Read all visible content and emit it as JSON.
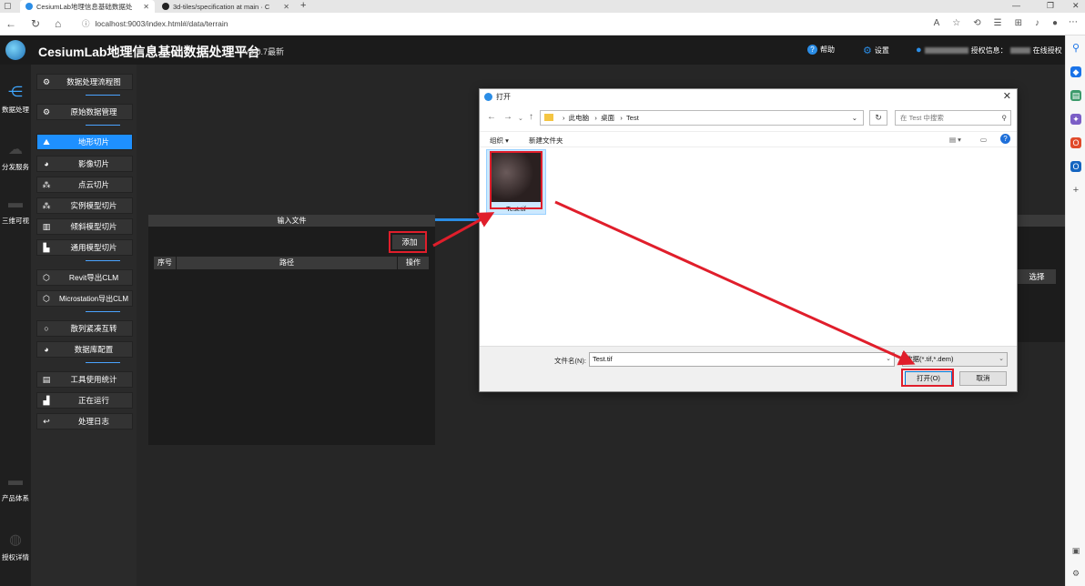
{
  "browser": {
    "tabs": [
      {
        "label": "CesiumLab地理信息基础数据处",
        "active": true
      },
      {
        "label": "3d-tiles/specification at main · C",
        "active": false
      }
    ],
    "url": "localhost:9003/index.html#/data/terrain",
    "nav_icons": [
      "back-icon",
      "refresh-icon",
      "home-icon",
      "info-icon",
      "read-aloud-icon",
      "favorite-icon",
      "extensions-icon",
      "favorites-icon",
      "collections-icon",
      "bell-icon",
      "profile-icon",
      "more-icon"
    ]
  },
  "app": {
    "title": "CesiumLab地理信息基础数据处理平台",
    "version": "V3.0.7最新",
    "header": {
      "help": "帮助",
      "settings": "设置",
      "license_prefix": "授权信息：",
      "license_status": "在线授权"
    },
    "leftnav": [
      {
        "label": "数据处理",
        "icon": "data-process-icon"
      },
      {
        "label": "分发服务",
        "icon": "cloud-icon"
      },
      {
        "label": "三维可视",
        "icon": "3d-view-icon"
      },
      {
        "label": "产品体系",
        "icon": "product-icon"
      },
      {
        "label": "授权详情",
        "icon": "globe-icon"
      }
    ],
    "menu": [
      {
        "label": "数据处理流程图",
        "icon": "gear-icon"
      },
      {
        "label": "原始数据管理",
        "icon": "gear-icon"
      },
      {
        "label": "地形切片",
        "icon": "terrain-icon",
        "active": true
      },
      {
        "label": "影像切片",
        "icon": "globe-icon"
      },
      {
        "label": "点云切片",
        "icon": "nodes-icon"
      },
      {
        "label": "实例模型切片",
        "icon": "nodes-icon"
      },
      {
        "label": "倾斜模型切片",
        "icon": "building-icon"
      },
      {
        "label": "通用模型切片",
        "icon": "model-icon"
      },
      {
        "label": "Revit导出CLM",
        "icon": "hex-icon"
      },
      {
        "label": "Microstation导出CLM",
        "icon": "hex-icon"
      },
      {
        "label": "散列紧凑互转",
        "icon": "convert-icon"
      },
      {
        "label": "数据库配置",
        "icon": "globe-icon"
      },
      {
        "label": "工具使用统计",
        "icon": "doc-icon"
      },
      {
        "label": "正在运行",
        "icon": "chart-icon"
      },
      {
        "label": "处理日志",
        "icon": "return-icon"
      }
    ],
    "input_panel": {
      "title": "输入文件",
      "add_button": "添加",
      "columns": [
        "序号",
        "路径",
        "操作"
      ]
    },
    "right_panel": {
      "select_button": "选择"
    }
  },
  "dialog": {
    "title": "打开",
    "breadcrumb": [
      "此电脑",
      "桌面",
      "Test"
    ],
    "search_placeholder": "在 Test 中搜索",
    "toolbar": {
      "organize": "组织 ▾",
      "new_folder": "新建文件夹"
    },
    "files": [
      {
        "name": "Test.tif"
      }
    ],
    "filename_label": "文件名(N):",
    "filename_value": "Test.tif",
    "filetype_value": "数据(*.tif,*.dem)",
    "open_button": "打开(O)",
    "cancel_button": "取消"
  },
  "colors": {
    "accent": "#1e90ff",
    "highlight": "#e01e2b",
    "app_bg": "#262626"
  }
}
